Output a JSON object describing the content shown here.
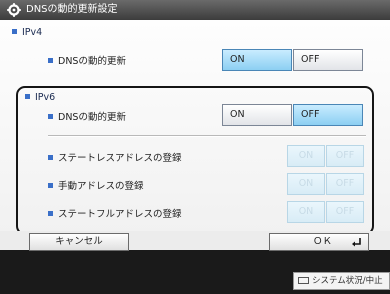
{
  "title": "DNSの動的更新設定",
  "ipv4": {
    "heading": "IPv4",
    "dynamic_update": {
      "label": "DNSの動的更新",
      "on": "ON",
      "off": "OFF",
      "selected": "ON"
    }
  },
  "ipv6": {
    "heading": "IPv6",
    "dynamic_update": {
      "label": "DNSの動的更新",
      "on": "ON",
      "off": "OFF",
      "selected": "OFF"
    },
    "stateless": {
      "label": "ステートレスアドレスの登録",
      "on": "ON",
      "off": "OFF"
    },
    "manual": {
      "label": "手動アドレスの登録",
      "on": "ON",
      "off": "OFF"
    },
    "stateful": {
      "label": "ステートフルアドレスの登録",
      "on": "ON",
      "off": "OFF"
    }
  },
  "buttons": {
    "cancel": "キャンセル",
    "ok": "ＯＫ"
  },
  "status_bar": {
    "label": "システム状況/中止"
  },
  "colors": {
    "selected": "#8ccff2",
    "bullet": "#3a6fc8",
    "title_bar": "#4a4a4a"
  }
}
